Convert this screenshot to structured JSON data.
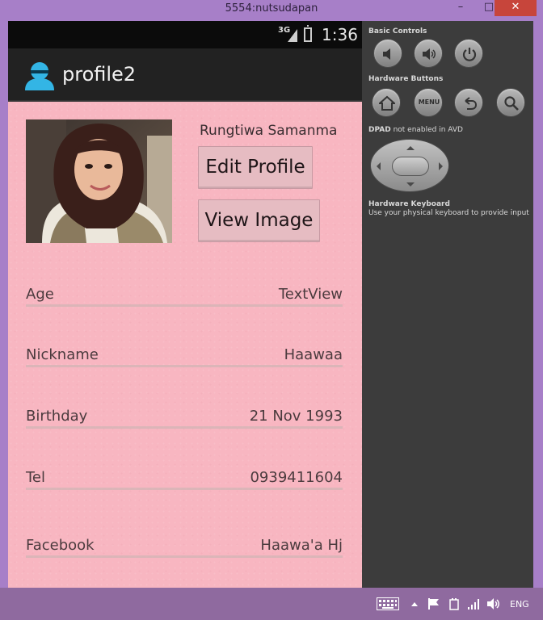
{
  "window": {
    "title": "5554:nutsudapan",
    "minimize_glyph": "–",
    "maximize_glyph": "□",
    "close_glyph": "✕"
  },
  "statusbar": {
    "network": "3G",
    "time": "1:36"
  },
  "app": {
    "title": "profile2",
    "icon": "person-icon"
  },
  "profile": {
    "name": "Rungtiwa Samanma",
    "edit_button": "Edit Profile",
    "view_button": "View Image"
  },
  "fields": [
    {
      "label": "Age",
      "value": "TextView"
    },
    {
      "label": "Nickname",
      "value": "Haawaa"
    },
    {
      "label": "Birthday",
      "value": "21 Nov 1993"
    },
    {
      "label": "Tel",
      "value": "0939411604"
    },
    {
      "label": "Facebook",
      "value": "Haawa'a Hj"
    }
  ],
  "emulator": {
    "basic_controls": "Basic Controls",
    "hardware_buttons": "Hardware Buttons",
    "menu_label": "MENU",
    "dpad_title": "DPAD",
    "dpad_note": "not enabled in AVD",
    "keyboard_title": "Hardware Keyboard",
    "keyboard_note": "Use your physical keyboard to provide input"
  },
  "taskbar": {
    "language": "ENG"
  },
  "colors": {
    "screen_bg": "#f8b6c1",
    "actionbar": "#222222",
    "button_bg": "#e6bcc2",
    "window_frame": "#a77fc8",
    "close_button": "#c7453b"
  }
}
